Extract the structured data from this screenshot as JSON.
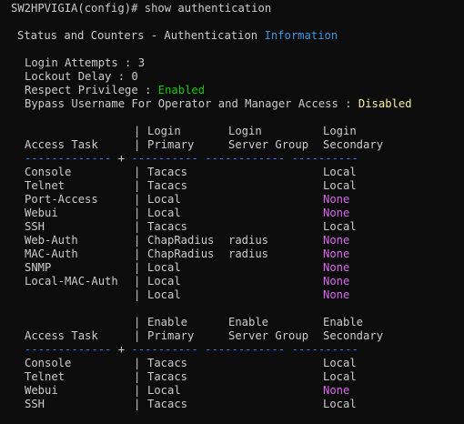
{
  "prompt": "SW2HPVIGIA(config)# show authentication",
  "header": {
    "title_main": "Status and Counters - Authentication ",
    "title_highlight": "Information"
  },
  "settings": {
    "login_attempts": "Login Attempts : 3",
    "lockout_delay": "Lockout Delay : 0",
    "respect_privilege_label": "Respect Privilege : ",
    "respect_privilege_value": "Enabled",
    "bypass_label": "Bypass Username For Operator and Manager Access : ",
    "bypass_value": "Disabled"
  },
  "login_table": {
    "header1": "          | Login      Login        Login",
    "header2_prefix": "Access Task   | Primary    Server Group Secondary",
    "separator_left": "------------- ",
    "separator_plus": "+",
    "separator_right": " ---------- ------------ ----------",
    "rows": [
      {
        "task": "Console",
        "primary": "Tacacs",
        "server_group": "",
        "secondary": "Local",
        "secondary_color": "default"
      },
      {
        "task": "Telnet",
        "primary": "Tacacs",
        "server_group": "",
        "secondary": "Local",
        "secondary_color": "default"
      },
      {
        "task": "Port-Access",
        "primary": "Local",
        "server_group": "",
        "secondary": "None",
        "secondary_color": "magenta"
      },
      {
        "task": "Webui",
        "primary": "Local",
        "server_group": "",
        "secondary": "None",
        "secondary_color": "magenta"
      },
      {
        "task": "SSH",
        "primary": "Tacacs",
        "server_group": "",
        "secondary": "Local",
        "secondary_color": "default"
      },
      {
        "task": "Web-Auth",
        "primary": "ChapRadius",
        "server_group": "radius",
        "secondary": "None",
        "secondary_color": "magenta"
      },
      {
        "task": "MAC-Auth",
        "primary": "ChapRadius",
        "server_group": "radius",
        "secondary": "None",
        "secondary_color": "magenta"
      },
      {
        "task": "SNMP",
        "primary": "Local",
        "server_group": "",
        "secondary": "None",
        "secondary_color": "magenta"
      },
      {
        "task": "Local-MAC-Auth",
        "primary": "Local",
        "server_group": "",
        "secondary": "None",
        "secondary_color": "magenta"
      },
      {
        "task": "",
        "primary": "Local",
        "server_group": "",
        "secondary": "None",
        "secondary_color": "magenta"
      }
    ]
  },
  "enable_table": {
    "header1_col1": "Enable",
    "header1_col2": "Enable",
    "header1_col3": "Enable",
    "rows": [
      {
        "task": "Console",
        "primary": "Tacacs",
        "server_group": "",
        "secondary": "Local",
        "secondary_color": "default"
      },
      {
        "task": "Telnet",
        "primary": "Tacacs",
        "server_group": "",
        "secondary": "Local",
        "secondary_color": "default"
      },
      {
        "task": "Webui",
        "primary": "Local",
        "server_group": "",
        "secondary": "None",
        "secondary_color": "magenta"
      },
      {
        "task": "SSH",
        "primary": "Tacacs",
        "server_group": "",
        "secondary": "Local",
        "secondary_color": "default"
      }
    ]
  },
  "labels": {
    "login": "Login",
    "primary": "Primary",
    "server_group": "Server Group",
    "secondary": "Secondary",
    "access_task": "Access Task",
    "pipe": "|"
  },
  "colors": {
    "text": "#cccccc",
    "background": "#0c0c0c",
    "enabled": "#16c60c",
    "information": "#3a96dd",
    "disabled": "#f9f1a5",
    "none": "#d669ea",
    "separator": "#3b78ff"
  }
}
